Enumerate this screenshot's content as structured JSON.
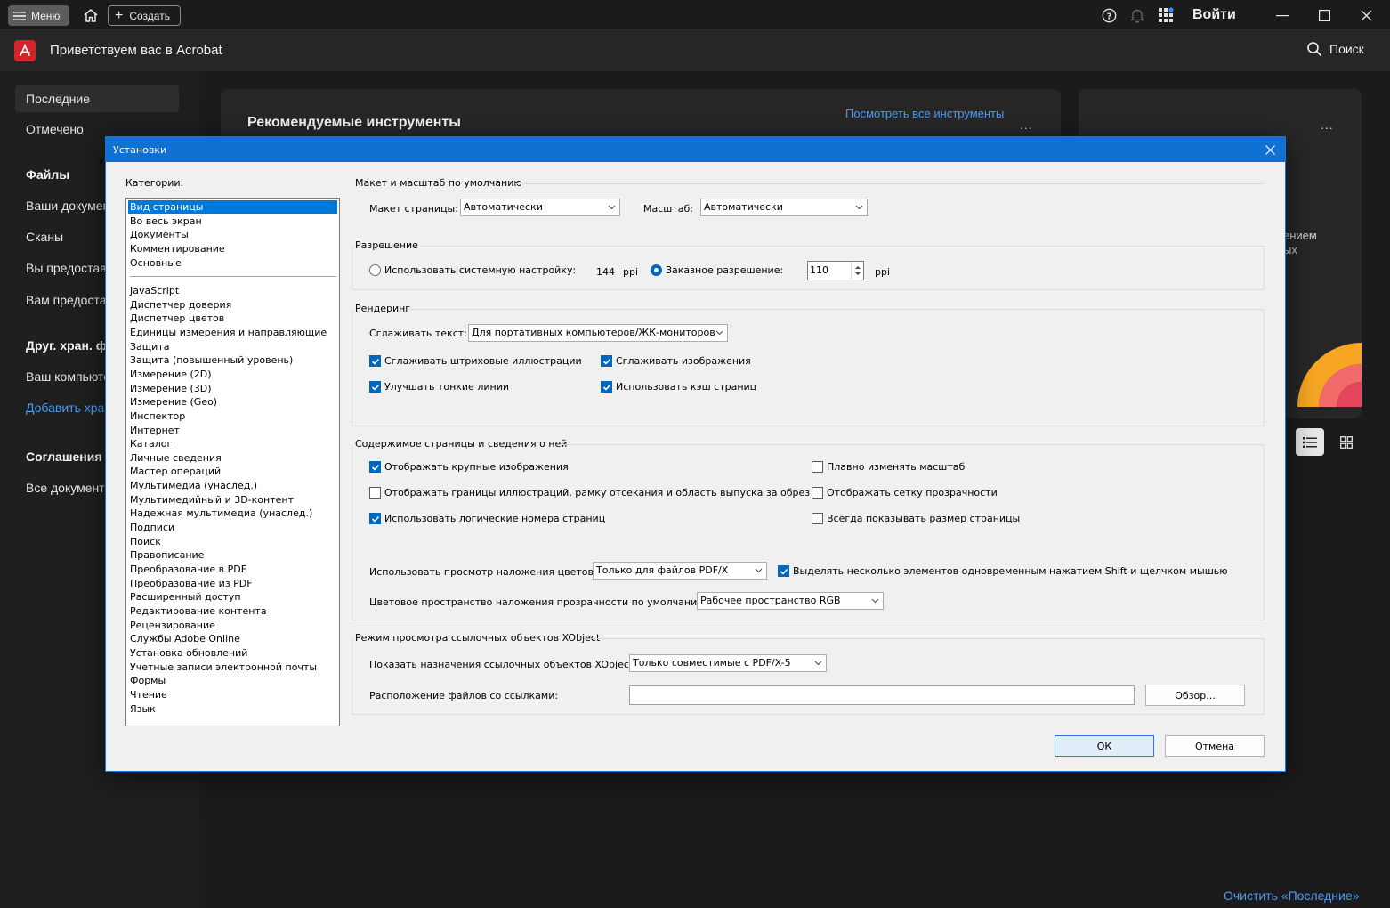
{
  "titlebar": {
    "menu_label": "Меню",
    "create_label": "Создать",
    "signin_label": "Войти"
  },
  "header": {
    "title": "Приветствуем вас в Acrobat",
    "search_label": "Поиск"
  },
  "sidebar": {
    "recent": "Последние",
    "starred": "Отмечено",
    "files_head": "Файлы",
    "your_docs": "Ваши докумен",
    "scans": "Сканы",
    "shared_by_you": "Вы предостав",
    "shared_with_you": "Вам предоста",
    "other_storage_head": "Друг. хран. ф",
    "your_computer": "Ваш компьюте",
    "add_storage": "Добавить хран",
    "agreements_head": "Соглашения",
    "all_docs": "Все документ"
  },
  "main": {
    "recommended_tools": "Рекомендуемые инструменты",
    "see_all_tools": "Посмотреть все инструменты",
    "more_dots": "...",
    "card2_frag1": "ением",
    "card2_frag2": "ых",
    "clear_recent": "Очистить «Последние»"
  },
  "dialog": {
    "title": "Установки",
    "categories_label": "Категории:",
    "categories_top": [
      "Вид страницы",
      "Во весь экран",
      "Документы",
      "Комментирование",
      "Основные"
    ],
    "categories": [
      "JavaScript",
      "Диспетчер доверия",
      "Диспетчер цветов",
      "Единицы измерения и направляющие",
      "Защита",
      "Защита (повышенный уровень)",
      "Измерение (2D)",
      "Измерение (3D)",
      "Измерение (Geo)",
      "Инспектор",
      "Интернет",
      "Каталог",
      "Личные сведения",
      "Мастер операций",
      "Мультимедиа (унаслед.)",
      "Мультимедийный и 3D-контент",
      "Надежная мультимедиа (унаслед.)",
      "Подписи",
      "Поиск",
      "Правописание",
      "Преобразование в PDF",
      "Преобразование из PDF",
      "Расширенный доступ",
      "Редактирование контента",
      "Рецензирование",
      "Службы Adobe Online",
      "Установка обновлений",
      "Учетные записи электронной почты",
      "Формы",
      "Чтение",
      "Язык"
    ],
    "layout": {
      "group": "Макет и масштаб по умолчанию",
      "page_layout_label": "Макет страницы:",
      "page_layout_value": "Автоматически",
      "zoom_label": "Масштаб:",
      "zoom_value": "Автоматически"
    },
    "resolution": {
      "group": "Разрешение",
      "system_label": "Использовать системную настройку:",
      "system_value": "144",
      "ppi": "ppi",
      "custom_label": "Заказное разрешение:",
      "custom_value": "110"
    },
    "rendering": {
      "group": "Рендеринг",
      "smooth_text_label": "Сглаживать текст:",
      "smooth_text_value": "Для портативных компьютеров/ЖК-мониторов",
      "smooth_line_art": "Сглаживать штриховые иллюстрации",
      "smooth_images": "Сглаживать изображения",
      "enhance_thin_lines": "Улучшать тонкие линии",
      "use_page_cache": "Использовать кэш страниц"
    },
    "content": {
      "group": "Содержимое страницы и сведения о ней",
      "show_large_images": "Отображать крупные изображения",
      "smooth_zoom": "Плавно изменять масштаб",
      "show_art_trim_bleed": "Отображать границы иллюстраций, рамку отсекания и область выпуска за обрез",
      "show_transparency_grid": "Отображать сетку прозрачности",
      "use_logical_page_numbers": "Использовать логические номера страниц",
      "always_show_page_size": "Всегда показывать размер страницы",
      "overprint_label": "Использовать просмотр наложения цветов:",
      "overprint_value": "Только для файлов PDF/X",
      "shift_select": "Выделять несколько элементов одновременным нажатием Shift и щелчком мышью",
      "blend_space_label": "Цветовое пространство наложения прозрачности по умолчанию:",
      "blend_space_value": "Рабочее пространство RGB"
    },
    "xobject": {
      "group": "Режим просмотра ссылочных объектов XObject",
      "show_targets_label": "Показать назначения ссылочных объектов XObject:",
      "show_targets_value": "Только совместимые с PDF/X-5",
      "files_location_label": "Расположение файлов со ссылками:",
      "files_location_value": "",
      "browse": "Обзор..."
    },
    "ok": "ОК",
    "cancel": "Отмена"
  },
  "colors": {
    "accent": "#1070d4",
    "link": "#4d9bf5",
    "brand_red": "#d4242b"
  }
}
